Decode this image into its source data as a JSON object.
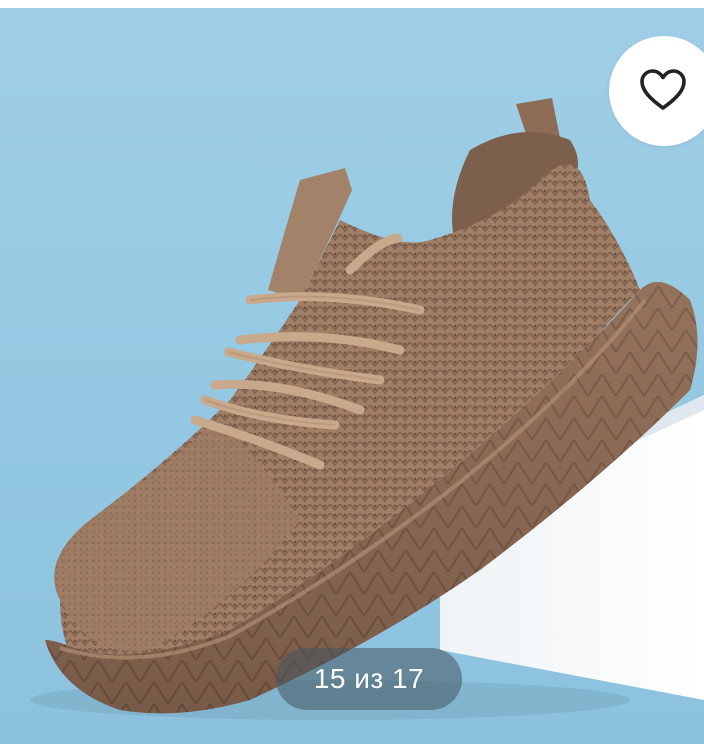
{
  "gallery": {
    "image_alt": "Sneaker",
    "counter": "15 из 17",
    "current": 15,
    "total": 17
  },
  "favorite": {
    "icon": "heart-outline-icon"
  },
  "colors": {
    "background": "#9fcfe6",
    "shoe": "#9c7a62",
    "sole": "#8f6e57",
    "pedestal": "#ffffff",
    "counter_bg": "#465660",
    "heart": "#222222"
  }
}
